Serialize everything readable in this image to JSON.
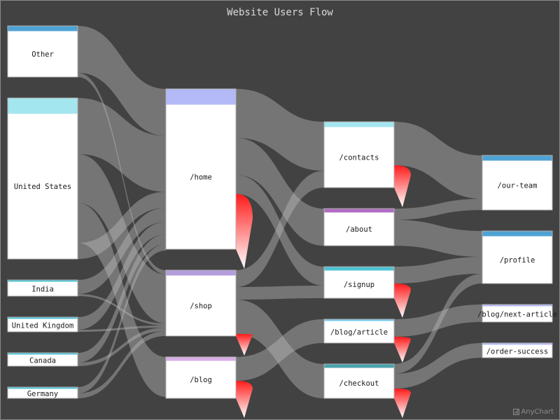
{
  "chart_data": {
    "type": "sankey",
    "title": "Website Users Flow",
    "columns": [
      [
        "Other",
        "United States",
        "India",
        "United Kingdom",
        "Canada",
        "Germany"
      ],
      [
        "/home",
        "/shop",
        "/blog"
      ],
      [
        "/contacts",
        "/about",
        "/signup",
        "/blog/article",
        "/checkout"
      ],
      [
        "/our-team",
        "/profile",
        "/blog/next-article",
        "/order-success"
      ]
    ],
    "nodes": [
      {
        "name": "Other",
        "color": "#4fa3d4",
        "value": 73
      },
      {
        "name": "United States",
        "color": "#a3e6ef",
        "value": 230
      },
      {
        "name": "India",
        "color": "#4fc4d4",
        "value": 23
      },
      {
        "name": "United Kingdom",
        "color": "#4fc4d4",
        "value": 21
      },
      {
        "name": "Canada",
        "color": "#4fc4d4",
        "value": 19
      },
      {
        "name": "Germany",
        "color": "#4fc4d4",
        "value": 16
      },
      {
        "name": "/home",
        "color": "#b3baf7",
        "value": 229
      },
      {
        "name": "/shop",
        "color": "#b39ddb",
        "value": 94
      },
      {
        "name": "/blog",
        "color": "#d9aee6",
        "value": 59
      },
      {
        "name": "/contacts",
        "color": "#a3e6ef",
        "value": 94
      },
      {
        "name": "/about",
        "color": "#b06cc4",
        "value": 53
      },
      {
        "name": "/signup",
        "color": "#4fc4d4",
        "value": 45
      },
      {
        "name": "/blog/article",
        "color": "#6fc4ef",
        "value": 34
      },
      {
        "name": "/checkout",
        "color": "#4aa3ad",
        "value": 49
      },
      {
        "name": "/our-team",
        "color": "#4fa3d4",
        "value": 78
      },
      {
        "name": "/profile",
        "color": "#4fa3d4",
        "value": 75
      },
      {
        "name": "/blog/next-article",
        "color": "#b3baf7",
        "value": 25
      },
      {
        "name": "/order-success",
        "color": "#b3baf7",
        "value": 21
      }
    ],
    "links": [
      {
        "from": "Other",
        "to": "/home",
        "value": 67
      },
      {
        "from": "Other",
        "to": "/shop",
        "value": 6
      },
      {
        "from": "United States",
        "to": "/home",
        "value": 80
      },
      {
        "from": "United States",
        "to": "/shop",
        "value": 70
      },
      {
        "from": "United States",
        "to": "/blog",
        "value": 57
      },
      {
        "from": "United States",
        "to": "/home",
        "value": 23
      },
      {
        "from": "India",
        "to": "/home",
        "value": 20
      },
      {
        "from": "India",
        "to": "/shop",
        "value": 3
      },
      {
        "from": "United Kingdom",
        "to": "/home",
        "value": 18
      },
      {
        "from": "United Kingdom",
        "to": "/shop",
        "value": 3
      },
      {
        "from": "Canada",
        "to": "/home",
        "value": 14
      },
      {
        "from": "Canada",
        "to": "/shop",
        "value": 5
      },
      {
        "from": "Germany",
        "to": "/home",
        "value": 9
      },
      {
        "from": "Germany",
        "to": "/shop",
        "value": 7
      },
      {
        "from": "/home",
        "to": "/contacts",
        "value": 70
      },
      {
        "from": "/home",
        "to": "/about",
        "value": 53
      },
      {
        "from": "/home",
        "to": "/signup",
        "value": 27
      },
      {
        "from": "/home",
        "to": "dropoff",
        "value": 79
      },
      {
        "from": "/shop",
        "to": "/contacts",
        "value": 24
      },
      {
        "from": "/shop",
        "to": "/signup",
        "value": 18
      },
      {
        "from": "/shop",
        "to": "/checkout",
        "value": 49
      },
      {
        "from": "/shop",
        "to": "dropoff",
        "value": 3
      },
      {
        "from": "/blog",
        "to": "/blog/article",
        "value": 34
      },
      {
        "from": "/blog",
        "to": "dropoff",
        "value": 25
      },
      {
        "from": "/contacts",
        "to": "/our-team",
        "value": 62
      },
      {
        "from": "/contacts",
        "to": "dropoff",
        "value": 32
      },
      {
        "from": "/about",
        "to": "/our-team",
        "value": 16
      },
      {
        "from": "/about",
        "to": "/profile",
        "value": 37
      },
      {
        "from": "/signup",
        "to": "/profile",
        "value": 24
      },
      {
        "from": "/signup",
        "to": "dropoff",
        "value": 21
      },
      {
        "from": "/blog/article",
        "to": "/blog/next-article",
        "value": 25
      },
      {
        "from": "/blog/article",
        "to": "dropoff",
        "value": 9
      },
      {
        "from": "/checkout",
        "to": "/profile",
        "value": 14
      },
      {
        "from": "/checkout",
        "to": "/order-success",
        "value": 21
      },
      {
        "from": "/checkout",
        "to": "dropoff",
        "value": 14
      }
    ]
  },
  "credits": {
    "label": "AnyChart"
  }
}
